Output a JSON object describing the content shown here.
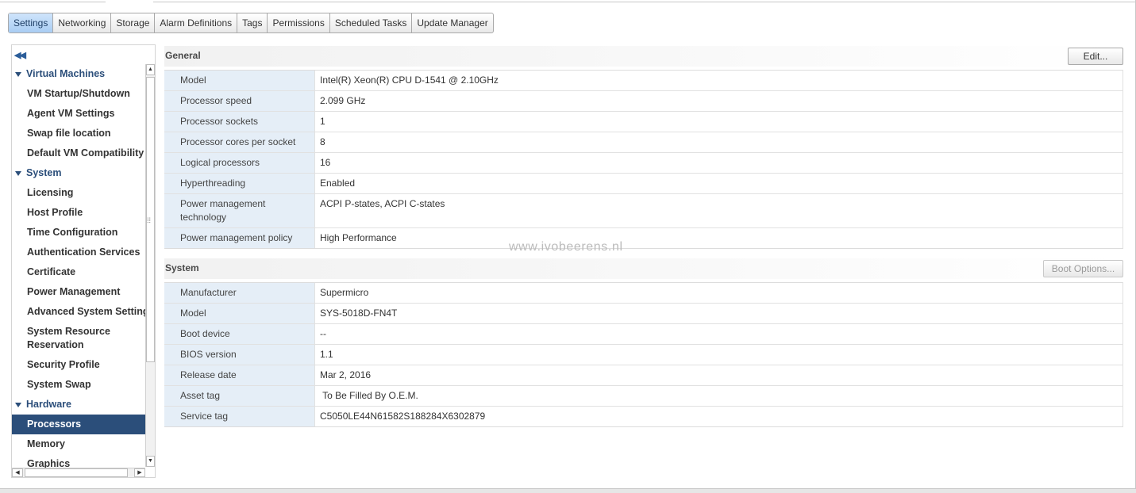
{
  "tabs": [
    {
      "label": "Settings"
    },
    {
      "label": "Networking"
    },
    {
      "label": "Storage"
    },
    {
      "label": "Alarm Definitions"
    },
    {
      "label": "Tags"
    },
    {
      "label": "Permissions"
    },
    {
      "label": "Scheduled Tasks"
    },
    {
      "label": "Update Manager"
    }
  ],
  "sidebar": {
    "groups": [
      {
        "label": "Virtual Machines",
        "items": [
          "VM Startup/Shutdown",
          "Agent VM Settings",
          "Swap file location",
          "Default VM Compatibility"
        ]
      },
      {
        "label": "System",
        "items": [
          "Licensing",
          "Host Profile",
          "Time Configuration",
          "Authentication Services",
          "Certificate",
          "Power Management",
          "Advanced System Settings",
          "System Resource Reservation",
          "Security Profile",
          "System Swap"
        ]
      },
      {
        "label": "Hardware",
        "items": [
          "Processors",
          "Memory",
          "Graphics"
        ]
      }
    ],
    "selected": "Processors"
  },
  "general": {
    "title": "General",
    "edit_label": "Edit...",
    "rows": [
      {
        "key": "Model",
        "value": "Intel(R) Xeon(R) CPU D-1541 @ 2.10GHz"
      },
      {
        "key": "Processor speed",
        "value": "2.099 GHz"
      },
      {
        "key": "Processor sockets",
        "value": "1"
      },
      {
        "key": "Processor cores per socket",
        "value": "8"
      },
      {
        "key": "Logical processors",
        "value": "16"
      },
      {
        "key": "Hyperthreading",
        "value": "Enabled"
      },
      {
        "key": "Power management technology",
        "value": "ACPI P-states, ACPI C-states"
      },
      {
        "key": "Power management policy",
        "value": "High Performance"
      }
    ]
  },
  "system": {
    "title": "System",
    "boot_options_label": "Boot Options...",
    "rows": [
      {
        "key": "Manufacturer",
        "value": "Supermicro"
      },
      {
        "key": "Model",
        "value": "SYS-5018D-FN4T"
      },
      {
        "key": "Boot device",
        "value": "--"
      },
      {
        "key": "BIOS version",
        "value": "1.1"
      },
      {
        "key": "Release date",
        "value": "Mar 2, 2016"
      },
      {
        "key": "Asset tag",
        "value": " To Be Filled By O.E.M."
      },
      {
        "key": "Service tag",
        "value": "C5050LE44N61582S188284X6302879"
      }
    ]
  },
  "watermark": "www.ivobeerens.nl"
}
